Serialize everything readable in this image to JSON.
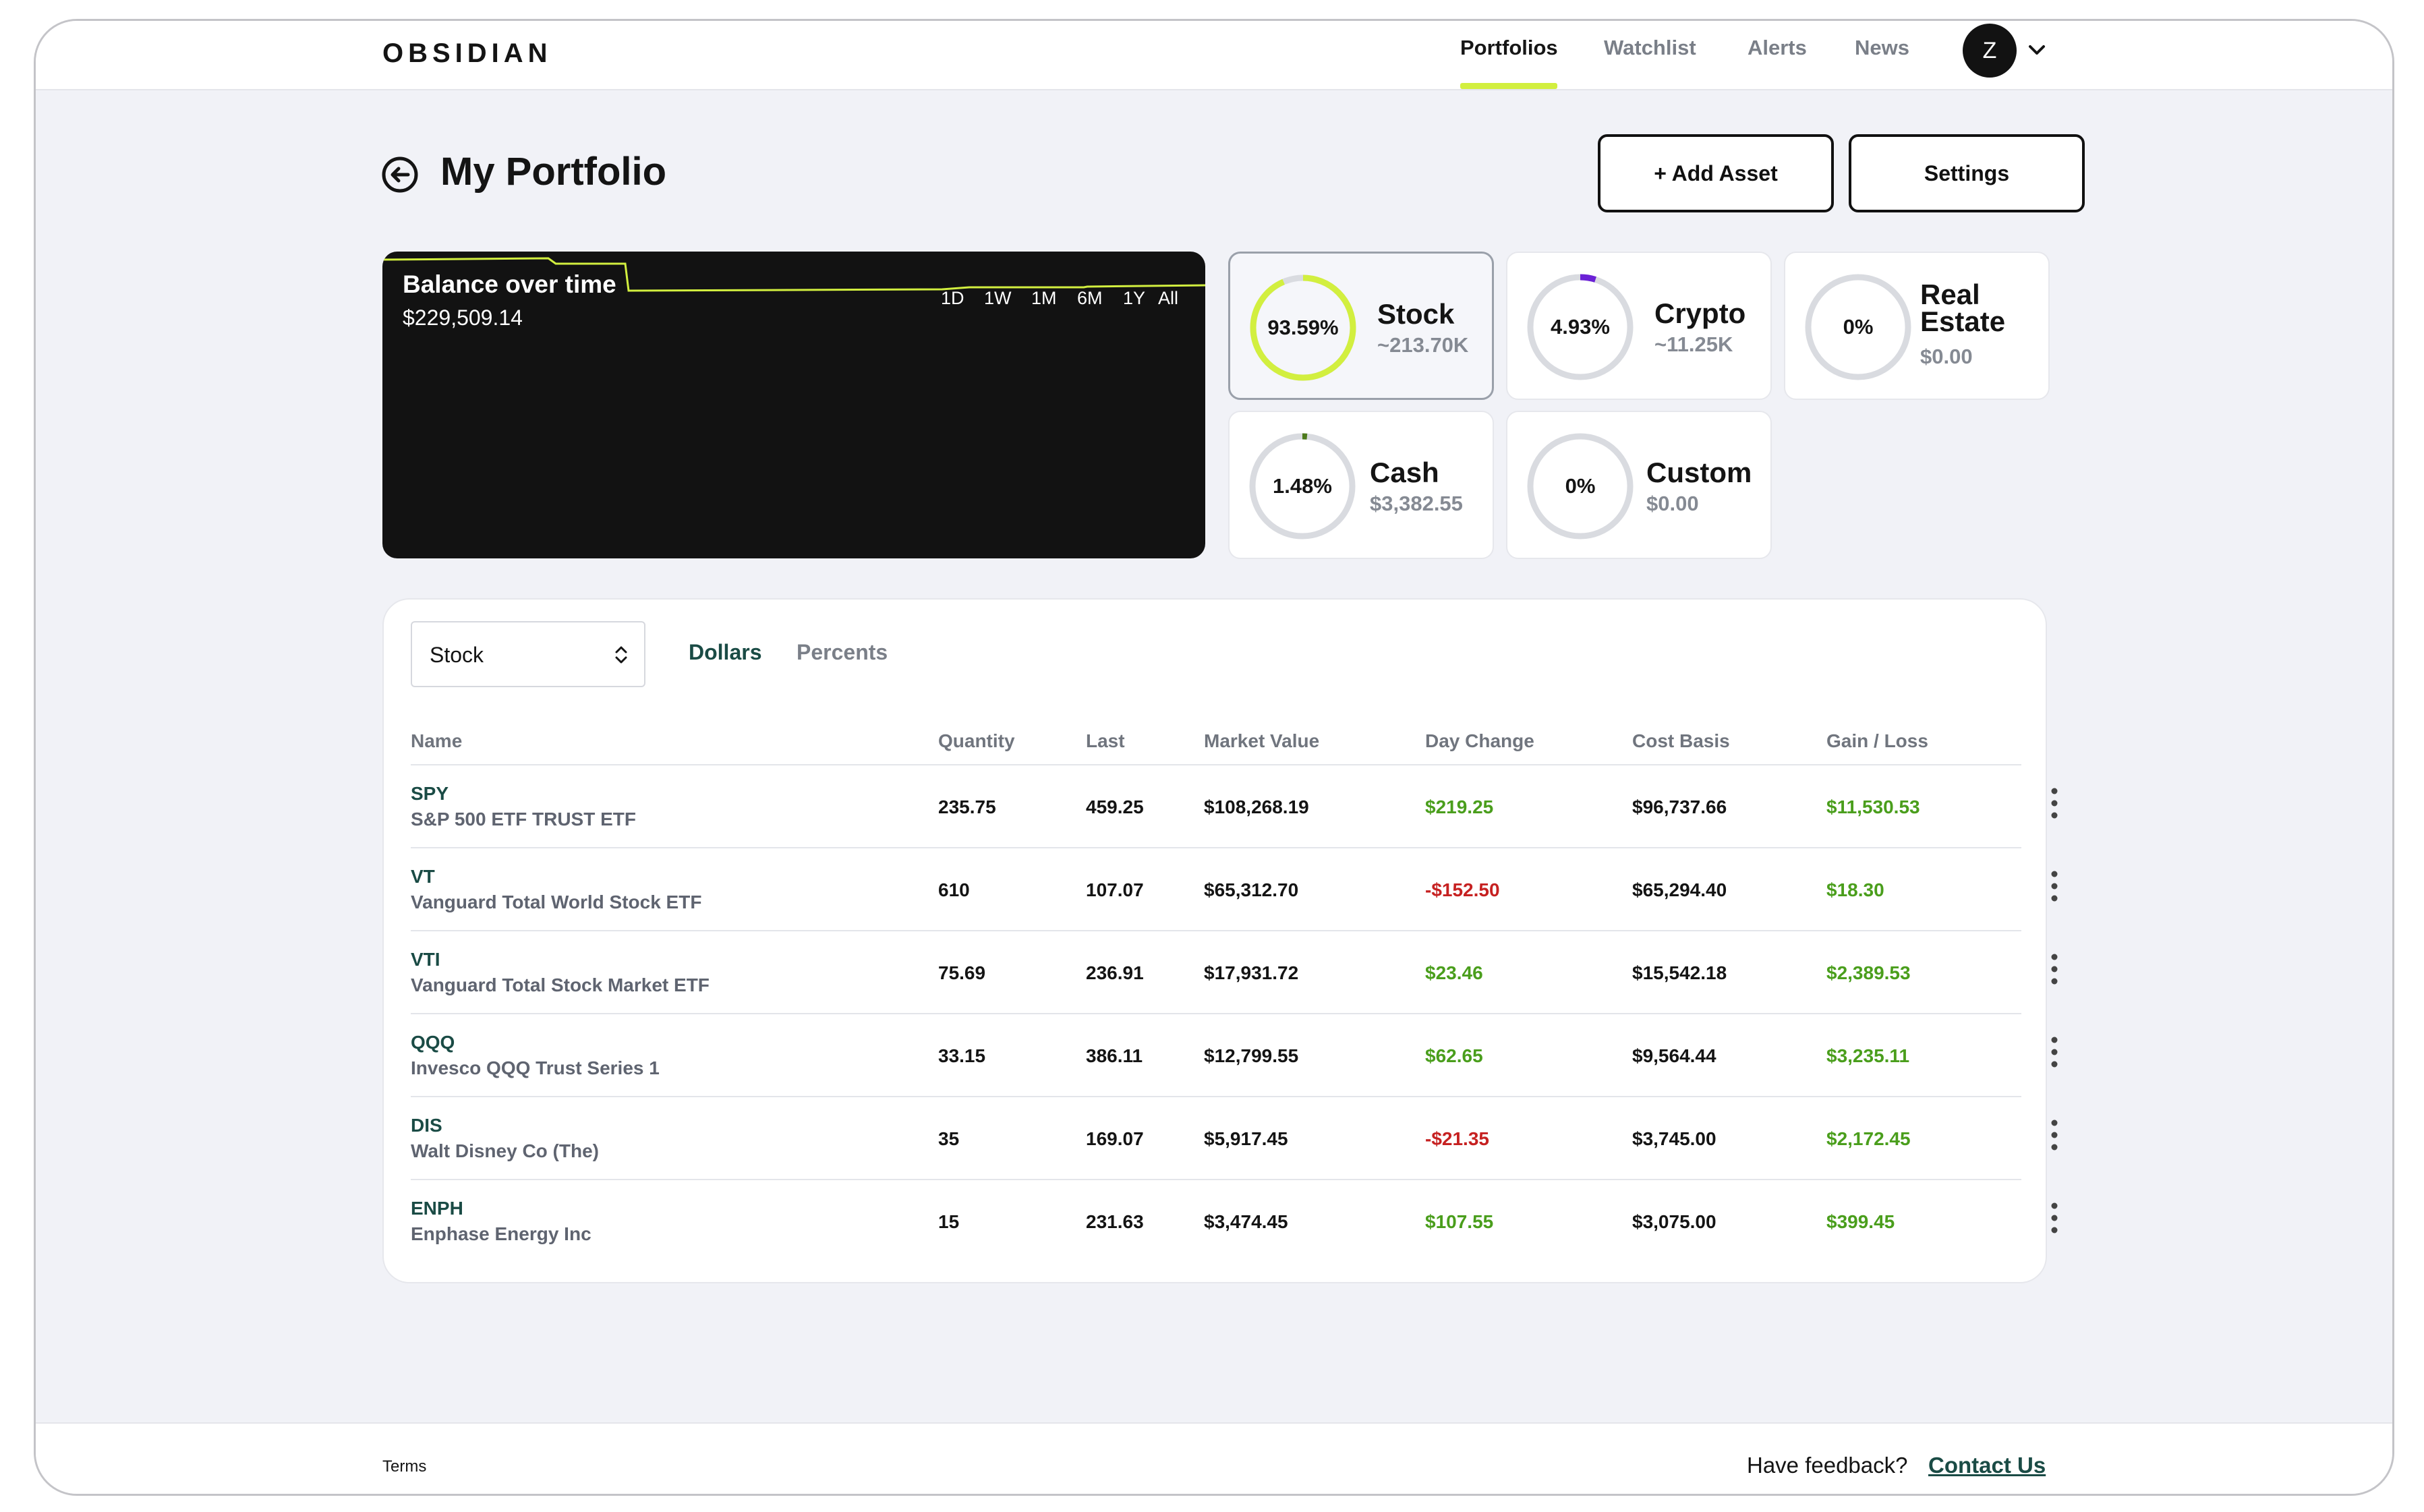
{
  "brand": {
    "logo": "OBSIDIAN"
  },
  "nav": {
    "items": [
      {
        "label": "Portfolios",
        "active": true
      },
      {
        "label": "Watchlist",
        "active": false
      },
      {
        "label": "Alerts",
        "active": false
      },
      {
        "label": "News",
        "active": false
      }
    ],
    "avatar_initial": "Z",
    "accent": "#d2ef3f"
  },
  "page": {
    "title": "My Portfolio",
    "add_asset_label": "+ Add Asset",
    "settings_label": "Settings"
  },
  "balance": {
    "title": "Balance over time",
    "value": "$229,509.14",
    "ranges": [
      "1D",
      "1W",
      "1M",
      "6M",
      "1Y",
      "All"
    ],
    "line_color": "#d2ef3f"
  },
  "allocations": [
    {
      "name": "Stock",
      "pct": "93.59%",
      "fraction": 0.9359,
      "value": "~213.70K",
      "color": "#d2ef3f",
      "selected": true
    },
    {
      "name": "Crypto",
      "pct": "4.93%",
      "fraction": 0.0493,
      "value": "~11.25K",
      "color": "#6b21d6",
      "selected": false
    },
    {
      "name": "Real Estate",
      "pct": "0%",
      "fraction": 0,
      "value": "$0.00",
      "color": "#d9dbe0",
      "selected": false
    },
    {
      "name": "Cash",
      "pct": "1.48%",
      "fraction": 0.0148,
      "value": "$3,382.55",
      "color": "#4d7a1c",
      "selected": false
    },
    {
      "name": "Custom",
      "pct": "0%",
      "fraction": 0,
      "value": "$0.00",
      "color": "#d9dbe0",
      "selected": false
    }
  ],
  "holdings": {
    "asset_type": "Stock",
    "view_toggle": {
      "dollars": "Dollars",
      "percents": "Percents",
      "active": "Dollars"
    },
    "columns": [
      "Name",
      "Quantity",
      "Last",
      "Market Value",
      "Day Change",
      "Cost Basis",
      "Gain / Loss"
    ],
    "rows": [
      {
        "ticker": "SPY",
        "company": "S&P 500 ETF TRUST ETF",
        "quantity": "235.75",
        "last": "459.25",
        "market_value": "$108,268.19",
        "day_change": "$219.25",
        "day_change_positive": true,
        "cost_basis": "$96,737.66",
        "gain_loss": "$11,530.53",
        "gain_loss_positive": true
      },
      {
        "ticker": "VT",
        "company": "Vanguard Total World Stock ETF",
        "quantity": "610",
        "last": "107.07",
        "market_value": "$65,312.70",
        "day_change": "-$152.50",
        "day_change_positive": false,
        "cost_basis": "$65,294.40",
        "gain_loss": "$18.30",
        "gain_loss_positive": true
      },
      {
        "ticker": "VTI",
        "company": "Vanguard Total Stock Market ETF",
        "quantity": "75.69",
        "last": "236.91",
        "market_value": "$17,931.72",
        "day_change": "$23.46",
        "day_change_positive": true,
        "cost_basis": "$15,542.18",
        "gain_loss": "$2,389.53",
        "gain_loss_positive": true
      },
      {
        "ticker": "QQQ",
        "company": "Invesco QQQ Trust Series 1",
        "quantity": "33.15",
        "last": "386.11",
        "market_value": "$12,799.55",
        "day_change": "$62.65",
        "day_change_positive": true,
        "cost_basis": "$9,564.44",
        "gain_loss": "$3,235.11",
        "gain_loss_positive": true
      },
      {
        "ticker": "DIS",
        "company": "Walt Disney Co (The)",
        "quantity": "35",
        "last": "169.07",
        "market_value": "$5,917.45",
        "day_change": "-$21.35",
        "day_change_positive": false,
        "cost_basis": "$3,745.00",
        "gain_loss": "$2,172.45",
        "gain_loss_positive": true
      },
      {
        "ticker": "ENPH",
        "company": "Enphase Energy Inc",
        "quantity": "15",
        "last": "231.63",
        "market_value": "$3,474.45",
        "day_change": "$107.55",
        "day_change_positive": true,
        "cost_basis": "$3,075.00",
        "gain_loss": "$399.45",
        "gain_loss_positive": true
      }
    ],
    "positive_color": "#4a9e1c",
    "negative_color": "#c62121"
  },
  "footer": {
    "terms": "Terms",
    "feedback": "Have feedback?",
    "contact": "Contact Us"
  }
}
